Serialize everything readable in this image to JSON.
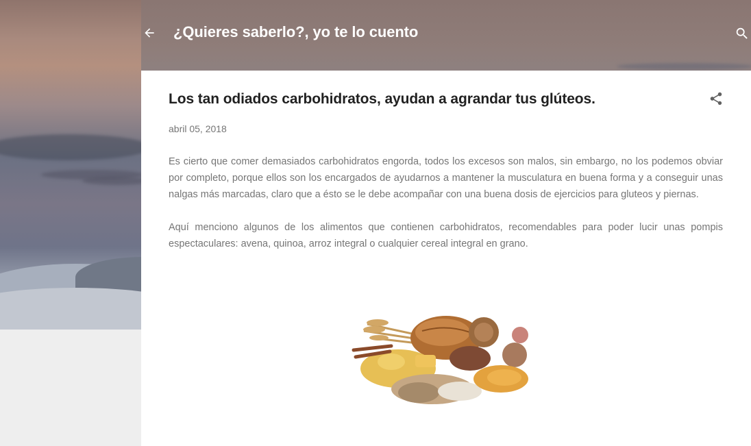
{
  "header": {
    "back_icon": "arrow-left-icon",
    "blog_title": "¿Quieres saberlo?, yo te lo cuento",
    "search_icon": "search-icon"
  },
  "post": {
    "title": "Los tan odiados carbohidratos, ayudan a agrandar tus glúteos.",
    "share_icon": "share-icon",
    "date": "abril 05, 2018",
    "paragraphs": [
      "Es cierto que comer demasiados carbohidratos engorda, todos los excesos son malos, sin embargo, no los podemos obviar por completo, porque ellos son los encargados de ayudarnos a mantener la musculatura en buena forma y a conseguir unas nalgas más marcadas, claro que a ésto se le debe acompañar con una buena dosis de ejercicios para gluteos y piernas.",
      "Aquí menciono algunos de los alimentos que contienen carbohidratos, recomendables para poder lucir unas pompis espectaculares: avena, quinoa, arroz integral o cualquier cereal integral en grano."
    ],
    "image_alt": "carbohydrate-foods-image"
  },
  "colors": {
    "title_text": "#212121",
    "body_text": "#757575",
    "card_bg": "#ffffff",
    "page_bg": "#eeeeee"
  }
}
